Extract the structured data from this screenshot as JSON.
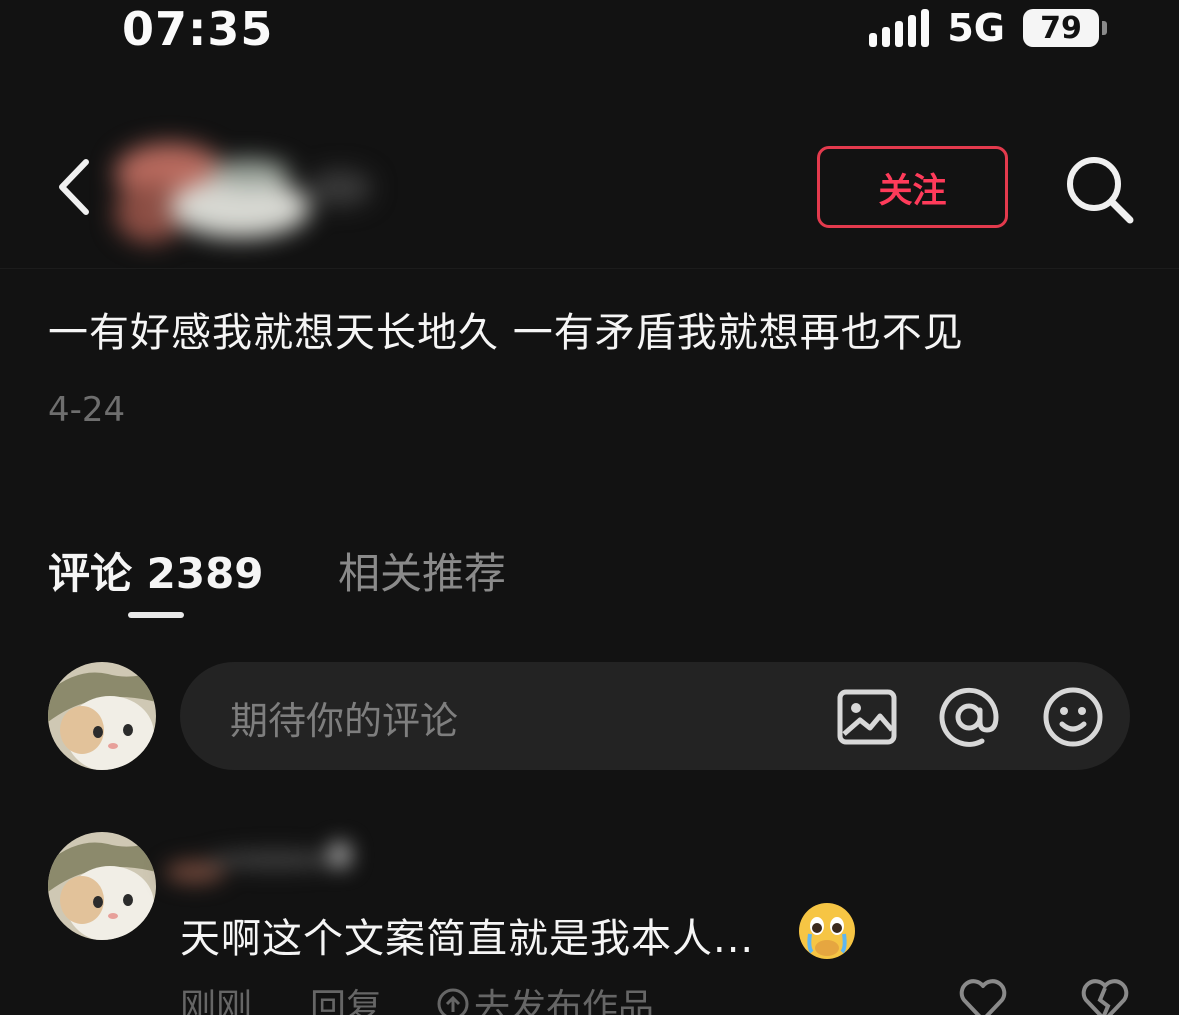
{
  "status_bar": {
    "time": "07:35",
    "network": "5G",
    "battery": "79"
  },
  "header": {
    "follow_label": "关注",
    "icons": [
      "back-icon",
      "search-icon"
    ]
  },
  "post": {
    "title": "一有好感我就想天长地久 一有矛盾我就想再也不见",
    "date": "4-24"
  },
  "tabs": [
    {
      "label": "评论 2389",
      "active": true
    },
    {
      "label": "相关推荐",
      "active": false
    }
  ],
  "comment_input": {
    "placeholder": "期待你的评论",
    "icons": [
      "image-icon",
      "at-icon",
      "emoji-icon"
    ]
  },
  "comment": {
    "text": "天啊这个文案简直就是我本人...",
    "emoji": "crying-face-emoji",
    "time": "刚刚",
    "reply_label": "回复",
    "publish_label": "去发布作品"
  },
  "colors": {
    "background": "#121212",
    "accent": "#e33a4d",
    "input_bg": "#232323",
    "muted": "#666666"
  }
}
